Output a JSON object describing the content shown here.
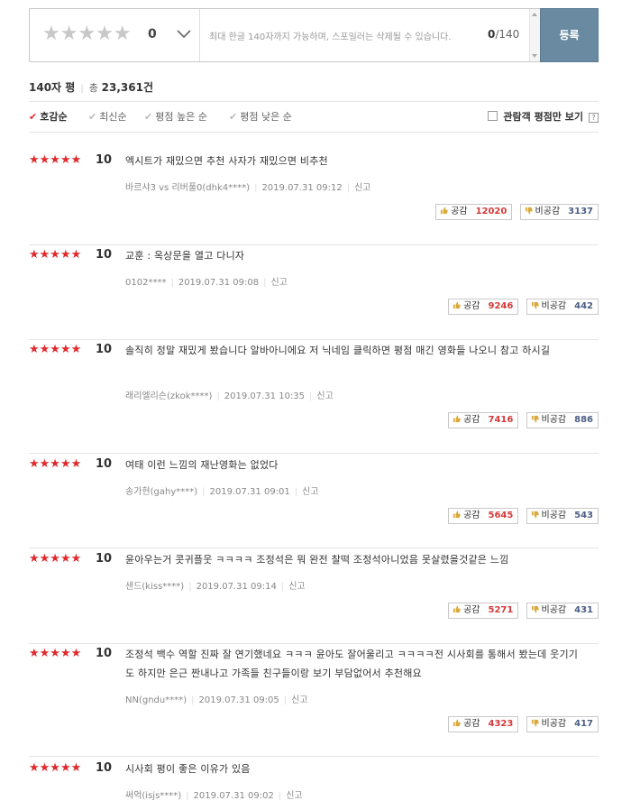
{
  "input": {
    "stars": "★★★★★",
    "score": "0",
    "placeholder": "최대 한글 140자까지 가능하며, 스포일러는 삭제될 수 있습니다.",
    "count_current": "0",
    "count_max": "/140",
    "submit_label": "등록"
  },
  "summary": {
    "title": "140자 평",
    "total_label": "총",
    "total_count": "23,361건"
  },
  "sort": {
    "items": [
      {
        "label": "호감순",
        "active": true
      },
      {
        "label": "최신순",
        "active": false
      },
      {
        "label": "평점 높은 순",
        "active": false
      },
      {
        "label": "평점 낮은 순",
        "active": false
      }
    ],
    "viewer_only_label": "관람객 평점만 보기",
    "help_label": "?"
  },
  "vote_labels": {
    "like": "공감",
    "dislike": "비공감"
  },
  "colors": {
    "accent_red": "#e0292c",
    "submit_bg": "#6a8aa2",
    "like_count": "#d43a3a",
    "dislike_count": "#4c5e85"
  },
  "reviews": [
    {
      "stars": "★★★★★",
      "score": "10",
      "text": "엑시트가 재밌으면 추천 사자가 재밌으면 비추천",
      "author": "바르샤3 vs 리버풀0(dhk4****)",
      "date": "2019.07.31 09:12",
      "report": "신고",
      "likes": "12020",
      "dislikes": "3137"
    },
    {
      "stars": "★★★★★",
      "score": "10",
      "text": "교훈 : 옥상문을 열고 다니자",
      "author": "0102****",
      "date": "2019.07.31 09:08",
      "report": "신고",
      "likes": "9246",
      "dislikes": "442"
    },
    {
      "stars": "★★★★★",
      "score": "10",
      "text": "솔직히 정말 재밌게 봤습니다 알바아니에요 저 닉네임 클릭하면 평점 매긴 영화들 나오니 참고 하시길",
      "author": "래리엘리슨(zkok****)",
      "date": "2019.07.31 10:35",
      "report": "신고",
      "likes": "7416",
      "dislikes": "886"
    },
    {
      "stars": "★★★★★",
      "score": "10",
      "text": "여태 이런 느낌의 재난영화는 없었다",
      "author": "송가현(gahy****)",
      "date": "2019.07.31 09:01",
      "report": "신고",
      "likes": "5645",
      "dislikes": "543"
    },
    {
      "stars": "★★★★★",
      "score": "10",
      "text": "윤아우는거 콧귀플웃 ㅋㅋㅋㅋ 조정석은 뭐 완전 찰떡 조정석아니었음 못살렸을것같은 느낌",
      "author": "샌드(kiss****)",
      "date": "2019.07.31 09:14",
      "report": "신고",
      "likes": "5271",
      "dislikes": "431"
    },
    {
      "stars": "★★★★★",
      "score": "10",
      "text": "조정석 백수 역할 진짜 잘 연기했네요 ㅋㅋㅋ 윤아도 잘어울리고 ㅋㅋㅋㅋ전 시사회를 통해서 봤는데 웃기기도 하지만 은근 짠내나고 가족들 친구들이랑 보기 부담없어서 추천해요",
      "author": "NN(gndu****)",
      "date": "2019.07.31 09:05",
      "report": "신고",
      "likes": "4323",
      "dislikes": "417"
    },
    {
      "stars": "★★★★★",
      "score": "10",
      "text": "시사회 평이 좋은 이유가 있음",
      "author": "써억(isjs****)",
      "date": "2019.07.31 09:02",
      "report": "신고",
      "likes": "",
      "dislikes": ""
    }
  ]
}
